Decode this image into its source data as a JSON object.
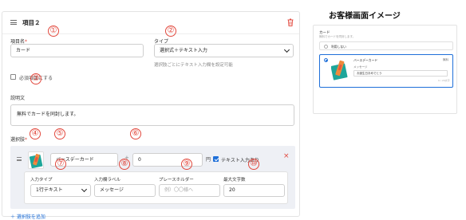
{
  "editor": {
    "header_title": "項目２",
    "field_name": {
      "label": "項目名",
      "required_mark": "*",
      "value": "カード"
    },
    "type": {
      "label": "タイプ",
      "selected": "選択式＋テキスト入力",
      "hint": "選択肢ごとにテキスト入力欄を設定可能"
    },
    "required_checkbox_label": "必須項目にする",
    "description": {
      "label": "説明文",
      "value": "無料でカードを同封します。"
    },
    "choices": {
      "label": "選択肢",
      "required_mark": "*",
      "item": {
        "name_value": "バースデーカード",
        "plus": "+",
        "price_value": "0",
        "price_unit": "円",
        "text_input_label": "テキスト入力あり",
        "text_input_checked": true,
        "delete": "×",
        "input_type": {
          "label": "入力タイプ",
          "selected": "1行テキスト"
        },
        "field_label": {
          "label": "入力欄ラベル",
          "value": "メッセージ"
        },
        "placeholder": {
          "label": "プレースホルダー",
          "placeholder": "例）〇〇様へ"
        },
        "max_chars": {
          "label": "最大文字数",
          "value": "20"
        }
      }
    },
    "add_choice": "＋ 選択肢を追加"
  },
  "badges": [
    "①",
    "②",
    "③",
    "④",
    "⑤",
    "⑥",
    "⑦",
    "⑧",
    "⑨",
    "⑩"
  ],
  "preview": {
    "title": "お客様画面イメージ",
    "field_label": "カード",
    "description": "無料でカードを同封します。",
    "option_none": "利用しない",
    "option_selected": {
      "name": "バースデーカード",
      "price": "無料",
      "input_label": "メッセージ",
      "input_value": "お誕生日おめでとう",
      "counter": "9 / 20文字"
    }
  },
  "colors": {
    "accent": "#1e6fd9",
    "danger": "#e2483d",
    "choice_bg": "#eef0f5"
  }
}
